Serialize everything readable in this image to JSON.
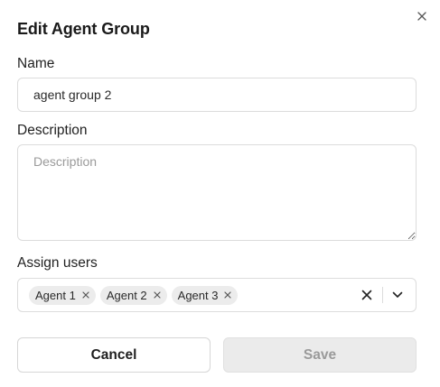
{
  "dialog": {
    "title": "Edit Agent Group",
    "close_icon": "close-icon"
  },
  "form": {
    "name": {
      "label": "Name",
      "value": "agent group 2"
    },
    "description": {
      "label": "Description",
      "value": "",
      "placeholder": "Description"
    },
    "assign_users": {
      "label": "Assign users",
      "selected": [
        "Agent 1",
        "Agent 2",
        "Agent 3"
      ],
      "clear_icon": "clear-icon",
      "dropdown_icon": "chevron-down-icon"
    }
  },
  "actions": {
    "cancel_label": "Cancel",
    "save_label": "Save",
    "save_disabled": true
  },
  "colors": {
    "border": "#dcdcdc",
    "chip_bg": "#ececec",
    "save_bg_disabled": "#ebebeb",
    "save_text_disabled": "#9a9a9a"
  }
}
